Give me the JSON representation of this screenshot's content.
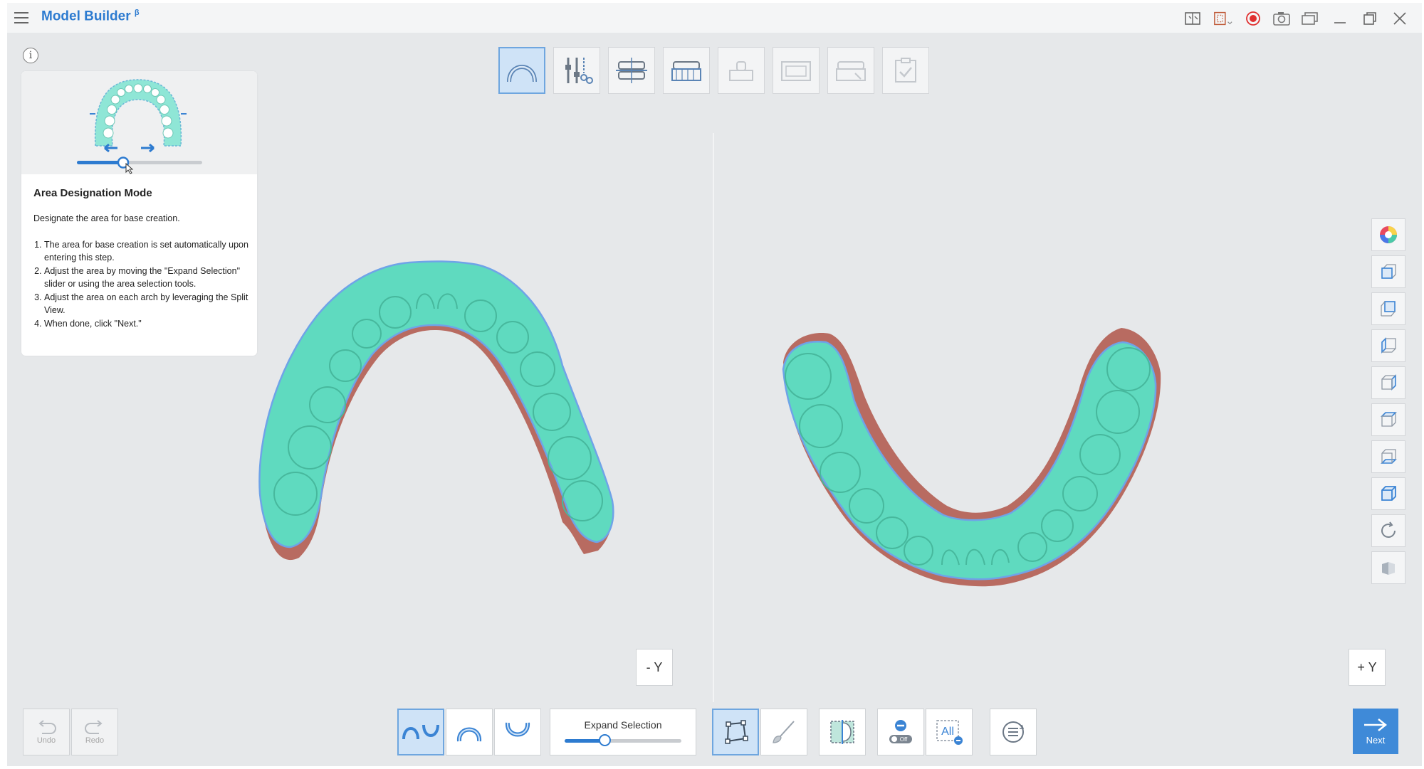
{
  "app": {
    "title": "Model Builder",
    "beta_mark": "β"
  },
  "colors": {
    "accent": "#2d7bd0",
    "gum": "#b8685e",
    "teeth": "#5ed9bd",
    "outline": "#6fa3e8"
  },
  "titlebar_icons": [
    "book-icon",
    "region-icon",
    "record-icon",
    "camera-icon",
    "window-switch-icon",
    "minimize-icon",
    "restore-icon",
    "close-icon"
  ],
  "steps": [
    {
      "name": "arch-area-step",
      "active": true
    },
    {
      "name": "trim-tools-step",
      "active": false
    },
    {
      "name": "occlusion-step",
      "active": false
    },
    {
      "name": "base-step",
      "active": false
    },
    {
      "name": "die-step",
      "active": false
    },
    {
      "name": "label-step",
      "active": false
    },
    {
      "name": "engrave-step",
      "active": false
    },
    {
      "name": "finish-step",
      "active": false
    }
  ],
  "info": {
    "icon_glyph": "i",
    "title": "Area Designation Mode",
    "description": "Designate the area for base creation.",
    "steps": [
      "The area for base creation is set automatically upon entering this step.",
      "Adjust the area by moving the \"Expand Selection\" slider or using the area selection tools.",
      "Adjust the area on each arch by leveraging the Split View.",
      "When done, click \"Next.\""
    ],
    "illustration_slider_level": 0.37
  },
  "viewports": {
    "left_view_label": "- Y",
    "right_view_label": "+ Y"
  },
  "side_tools": [
    "color-wheel-icon",
    "front-view-icon",
    "back-view-icon",
    "left-view-icon",
    "right-view-icon",
    "top-view-icon",
    "bottom-view-icon",
    "iso-view-icon",
    "reset-view-icon",
    "transparency-icon"
  ],
  "bottom": {
    "undo_label": "Undo",
    "redo_label": "Redo",
    "arch_modes": [
      "both-arches",
      "upper-arch",
      "lower-arch"
    ],
    "expand_selection_label": "Expand Selection",
    "expand_selection_level": 0.34,
    "all_label": "All",
    "off_label": "Off",
    "next_label": "Next"
  }
}
